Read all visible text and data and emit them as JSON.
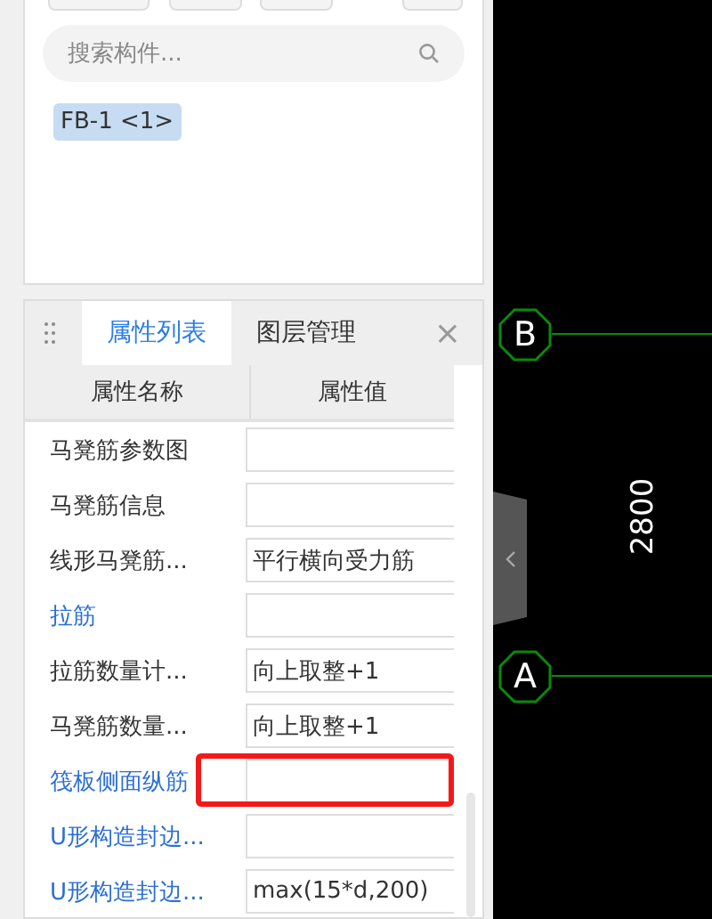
{
  "search": {
    "placeholder": "搜索构件..."
  },
  "component_tag": "FB-1 <1>",
  "tabs": [
    {
      "label": "属性列表",
      "selected": true
    },
    {
      "label": "图层管理",
      "selected": false
    }
  ],
  "close_label": "×",
  "table": {
    "columns": [
      "属性名称",
      "属性值"
    ],
    "rows": [
      {
        "name": "马凳筋参数图",
        "value": "",
        "kind": "plain",
        "highlighted": false
      },
      {
        "name": "马凳筋信息",
        "value": "",
        "kind": "plain",
        "highlighted": false
      },
      {
        "name": "线形马凳筋...",
        "value": "平行横向受力筋",
        "kind": "plain",
        "highlighted": false
      },
      {
        "name": "拉筋",
        "value": "",
        "kind": "public",
        "highlighted": false
      },
      {
        "name": "拉筋数量计...",
        "value": "向上取整+1",
        "kind": "plain",
        "highlighted": false
      },
      {
        "name": "马凳筋数量...",
        "value": "向上取整+1",
        "kind": "plain",
        "highlighted": false
      },
      {
        "name": "筏板侧面纵筋",
        "value": "",
        "kind": "public",
        "highlighted": true
      },
      {
        "name": "U形构造封边...",
        "value": "",
        "kind": "public",
        "highlighted": false
      },
      {
        "name": "U形构造封边...",
        "value": "max(15*d,200)",
        "kind": "public",
        "highlighted": false
      }
    ]
  },
  "canvas": {
    "axes": [
      {
        "label": "B"
      },
      {
        "label": "A"
      }
    ],
    "dimension": "2800"
  }
}
